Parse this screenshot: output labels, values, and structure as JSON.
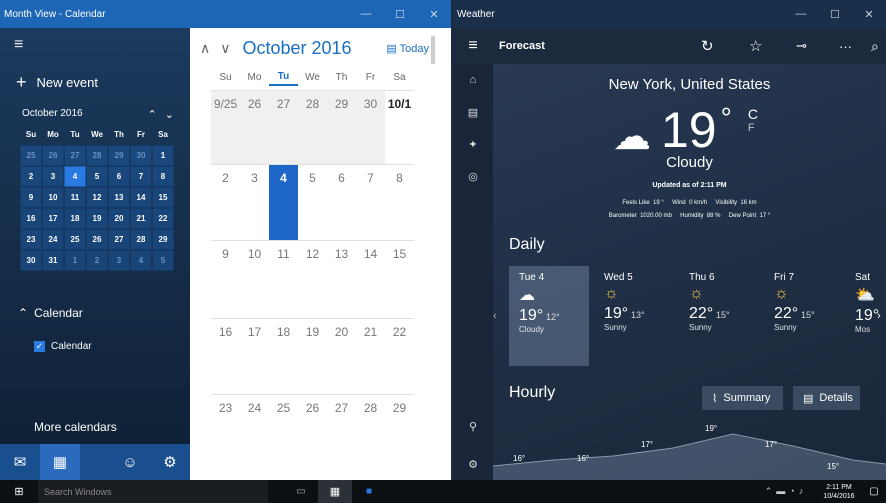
{
  "calendar": {
    "window_title": "Month View - Calendar",
    "new_event": "New event",
    "mini_month_title": "October 2016",
    "mini_dow": [
      "Su",
      "Mo",
      "Tu",
      "We",
      "Th",
      "Fr",
      "Sa"
    ],
    "mini_days": [
      [
        "25",
        "26",
        "27",
        "28",
        "29",
        "30",
        "1"
      ],
      [
        "2",
        "3",
        "4",
        "5",
        "6",
        "7",
        "8"
      ],
      [
        "9",
        "10",
        "11",
        "12",
        "13",
        "14",
        "15"
      ],
      [
        "16",
        "17",
        "18",
        "19",
        "20",
        "21",
        "22"
      ],
      [
        "23",
        "24",
        "25",
        "26",
        "27",
        "28",
        "29"
      ],
      [
        "30",
        "31",
        "1",
        "2",
        "3",
        "4",
        "5"
      ]
    ],
    "section_calendar": "Calendar",
    "calendar_item": "Calendar",
    "more_calendars": "More calendars",
    "month_title": "October 2016",
    "today_label": "Today",
    "dow": [
      "Su",
      "Mo",
      "Tu",
      "We",
      "Th",
      "Fr",
      "Sa"
    ],
    "weeks": [
      [
        "9/25",
        "26",
        "27",
        "28",
        "29",
        "30",
        "10/1"
      ],
      [
        "2",
        "3",
        "4",
        "5",
        "6",
        "7",
        "8"
      ],
      [
        "9",
        "10",
        "11",
        "12",
        "13",
        "14",
        "15"
      ],
      [
        "16",
        "17",
        "18",
        "19",
        "20",
        "21",
        "22"
      ],
      [
        "23",
        "24",
        "25",
        "26",
        "27",
        "28",
        "29"
      ]
    ]
  },
  "weather": {
    "window_title": "Weather",
    "toolbar_title": "Forecast",
    "location": "New York, United States",
    "temp": "19",
    "deg": "°",
    "unit_c": "C",
    "unit_f": "F",
    "condition": "Cloudy",
    "updated": "Updated as of 2:11 PM",
    "stats_line1": "Feels Like  19 °     Wind  0 km/h     Visibility  16 km",
    "stats_line2": "Barometer  1020.00 mb     Humidity  88 %     Dew Point  17 °",
    "daily_label": "Daily",
    "days": [
      {
        "day": "Tue 4",
        "hi": "19°",
        "lo": "12°",
        "cond": "Cloudy",
        "icon": "cloud-icon"
      },
      {
        "day": "Wed 5",
        "hi": "19°",
        "lo": "13°",
        "cond": "Sunny",
        "icon": "sun-icon"
      },
      {
        "day": "Thu 6",
        "hi": "22°",
        "lo": "15°",
        "cond": "Sunny",
        "icon": "sun-icon"
      },
      {
        "day": "Fri 7",
        "hi": "22°",
        "lo": "15°",
        "cond": "Sunny",
        "icon": "sun-icon"
      },
      {
        "day": "Sat",
        "hi": "19°",
        "lo": "",
        "cond": "Mos",
        "icon": "partly-sunny-icon"
      }
    ],
    "hourly_label": "Hourly",
    "summary_label": "Summary",
    "details_label": "Details",
    "hourly_temps": [
      "16°",
      "16°",
      "17°",
      "19°",
      "17°",
      "15°"
    ]
  },
  "taskbar": {
    "search_placeholder": "Search Windows",
    "time": "2:11 PM",
    "date": "10/4/2016"
  }
}
